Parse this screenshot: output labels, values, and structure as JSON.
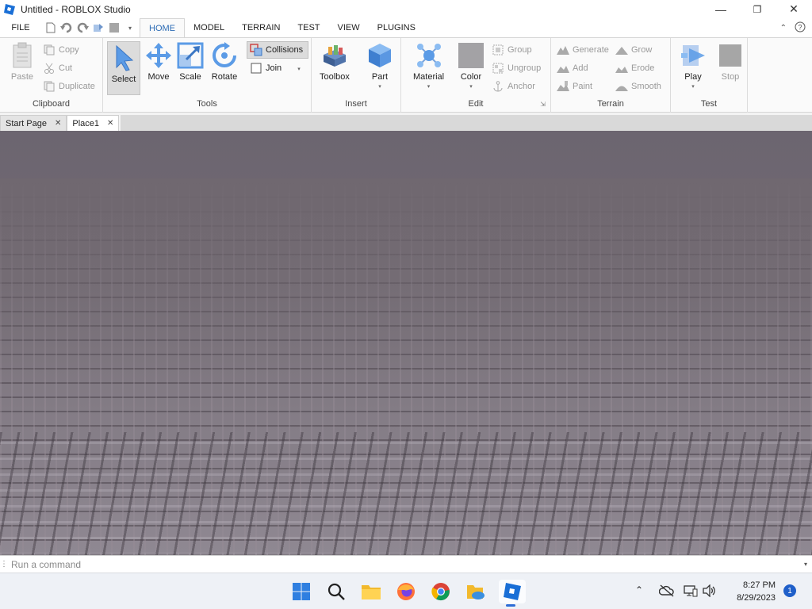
{
  "window": {
    "title": "Untitled - ROBLOX Studio"
  },
  "menu": {
    "file": "FILE",
    "tabs": [
      {
        "label": "HOME",
        "active": true
      },
      {
        "label": "MODEL"
      },
      {
        "label": "TERRAIN"
      },
      {
        "label": "TEST"
      },
      {
        "label": "VIEW"
      },
      {
        "label": "PLUGINS"
      }
    ]
  },
  "ribbon": {
    "clipboard": {
      "label": "Clipboard",
      "paste": "Paste",
      "copy": "Copy",
      "cut": "Cut",
      "duplicate": "Duplicate"
    },
    "tools": {
      "label": "Tools",
      "select": "Select",
      "move": "Move",
      "scale": "Scale",
      "rotate": "Rotate",
      "collisions": "Collisions",
      "join": "Join"
    },
    "insert": {
      "label": "Insert",
      "toolbox": "Toolbox",
      "part": "Part"
    },
    "edit": {
      "label": "Edit",
      "material": "Material",
      "color": "Color",
      "group": "Group",
      "ungroup": "Ungroup",
      "anchor": "Anchor"
    },
    "terrain": {
      "label": "Terrain",
      "generate": "Generate",
      "add": "Add",
      "paint": "Paint",
      "grow": "Grow",
      "erode": "Erode",
      "smooth": "Smooth"
    },
    "test": {
      "label": "Test",
      "play": "Play",
      "stop": "Stop"
    }
  },
  "doc_tabs": [
    {
      "label": "Start Page"
    },
    {
      "label": "Place1",
      "active": true
    }
  ],
  "command_bar": {
    "placeholder": "Run a command"
  },
  "taskbar": {
    "time": "8:27 PM",
    "date": "8/29/2023",
    "notifications": "1"
  },
  "colors": {
    "accent": "#2d6cb5",
    "viewport": "#706770",
    "taskbar": "#eef1f6"
  }
}
